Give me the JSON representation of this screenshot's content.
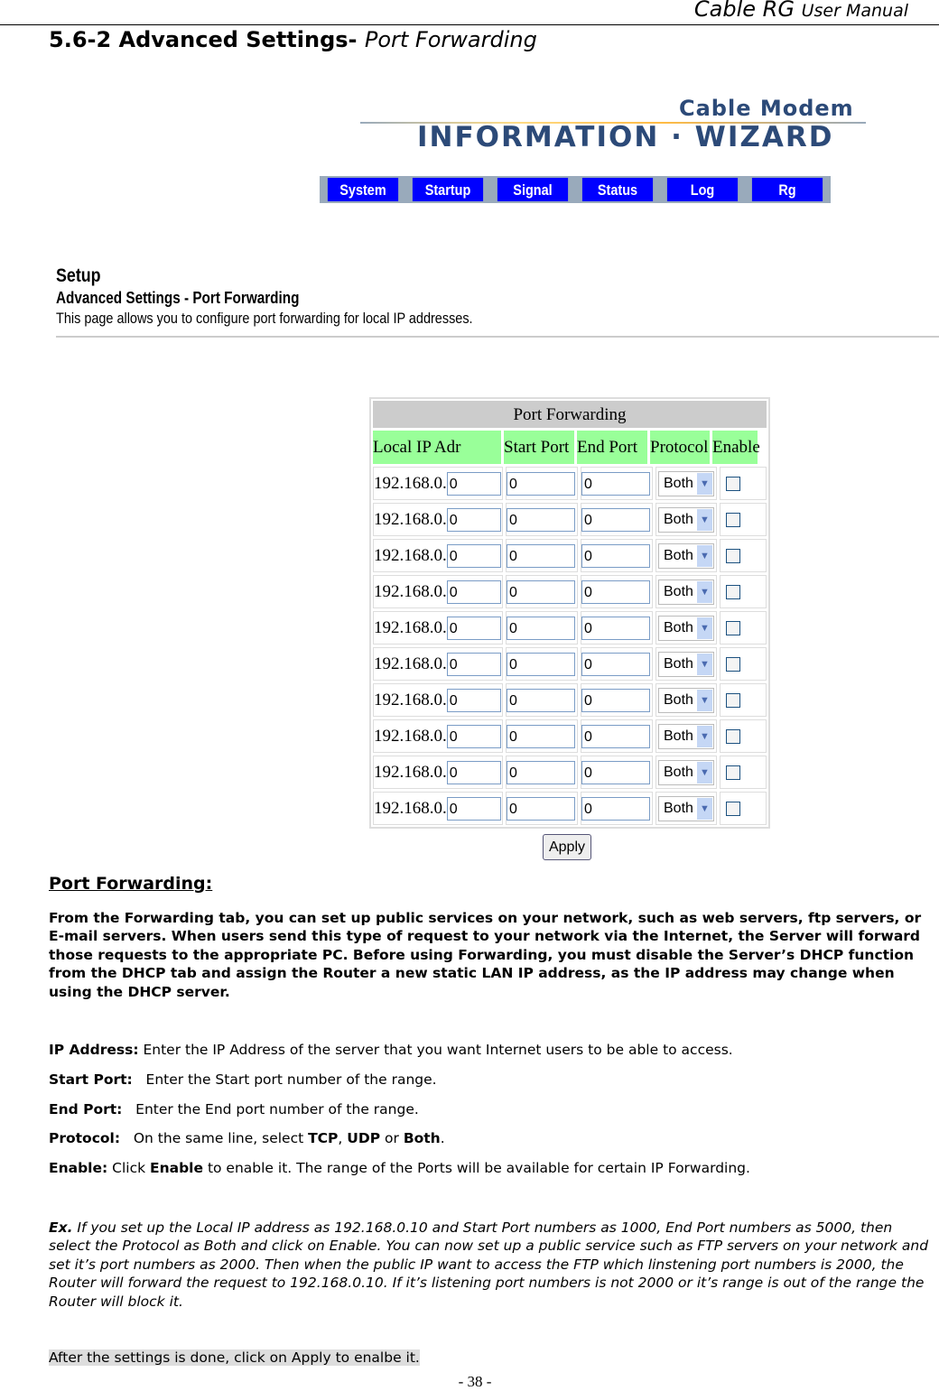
{
  "header": {
    "brand": "Cable RG",
    "manual": "User Manual"
  },
  "section": {
    "number_title": "5.6-2 Advanced Settings-",
    "subtitle": "Port Forwarding"
  },
  "logo": {
    "top": "Cable Modem",
    "bottom": "INFORMATION · WIZARD"
  },
  "nav": [
    "System",
    "Startup",
    "Signal",
    "Status",
    "Log",
    "Rg"
  ],
  "setup": {
    "title": "Setup",
    "subtitle": "Advanced Settings - Port Forwarding",
    "description": "This page allows you to configure port forwarding for local IP addresses."
  },
  "table": {
    "caption": "Port Forwarding",
    "headers": [
      "Local IP Adr",
      "Start Port",
      "End Port",
      "Protocol",
      "Enable"
    ],
    "ip_prefix": "192.168.0.",
    "rows": [
      {
        "ip": "0",
        "start": "0",
        "end": "0",
        "protocol": "Both",
        "enabled": false
      },
      {
        "ip": "0",
        "start": "0",
        "end": "0",
        "protocol": "Both",
        "enabled": false
      },
      {
        "ip": "0",
        "start": "0",
        "end": "0",
        "protocol": "Both",
        "enabled": false
      },
      {
        "ip": "0",
        "start": "0",
        "end": "0",
        "protocol": "Both",
        "enabled": false
      },
      {
        "ip": "0",
        "start": "0",
        "end": "0",
        "protocol": "Both",
        "enabled": false
      },
      {
        "ip": "0",
        "start": "0",
        "end": "0",
        "protocol": "Both",
        "enabled": false
      },
      {
        "ip": "0",
        "start": "0",
        "end": "0",
        "protocol": "Both",
        "enabled": false
      },
      {
        "ip": "0",
        "start": "0",
        "end": "0",
        "protocol": "Both",
        "enabled": false
      },
      {
        "ip": "0",
        "start": "0",
        "end": "0",
        "protocol": "Both",
        "enabled": false
      },
      {
        "ip": "0",
        "start": "0",
        "end": "0",
        "protocol": "Both",
        "enabled": false
      }
    ],
    "apply": "Apply"
  },
  "body": {
    "heading": "Port Forwarding:",
    "intro": "From the Forwarding tab, you can set up public services on your network, such as web servers, ftp servers, or E-mail servers. When users send this type of request to your network via the Internet, the Server will forward those requests to the appropriate PC. Before using Forwarding, you must disable the Server’s DHCP function from the DHCP tab and assign the Router a new static LAN IP address, as the IP address may change when using the DHCP server.",
    "ip_label": "IP Address:",
    "ip_text": " Enter the IP Address of the server that you want Internet users to be able to access.",
    "start_label": "Start Port:",
    "start_text": "   Enter the Start port number of the range.",
    "end_label": "End Port:",
    "end_text": "   Enter the End port number of the range.",
    "proto_label": "Protocol:",
    "proto_text1": "   On the same line, select ",
    "tcp": "TCP",
    ",": ", ",
    "udp": "UDP",
    "or": " or ",
    "both": "Both",
    "dot": ".",
    "enable_label": "Enable:",
    "enable_text1": " Click ",
    "enable_word": "Enable",
    "enable_text2": " to enable it. The range of the Ports will be available for certain IP Forwarding.",
    "ex_label": "Ex.",
    "ex_text": " If you set up the Local IP address as 192.168.0.10 and Start Port numbers as 1000, End Port numbers as 5000, then select the Protocol as Both and click on Enable. You can now set up a public service such as FTP servers on your network and set it’s port numbers as 2000. Then when the public IP want to access the FTP which linstening port numbers is 2000, the Router will forward the request to 192.168.0.10. If it’s listening port numbers is not 2000 or it’s range is out of the range the Router will block it.",
    "footer_note": "After the settings is done, click on Apply to enalbe it."
  },
  "page_number": "- 38 -"
}
